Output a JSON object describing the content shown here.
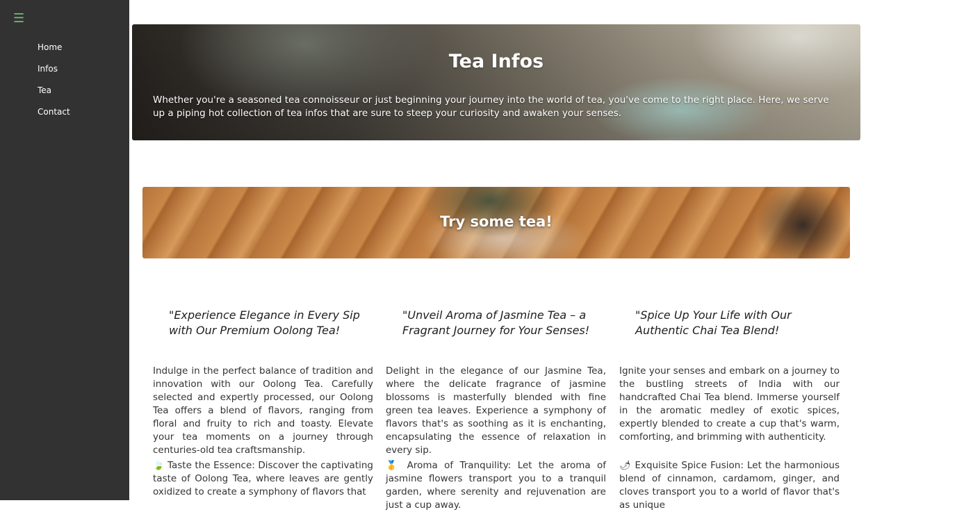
{
  "sidebar": {
    "menu_icon": "hamburger-menu-icon",
    "items": [
      {
        "label": "Home"
      },
      {
        "label": "Infos"
      },
      {
        "label": "Tea"
      },
      {
        "label": "Contact"
      }
    ]
  },
  "hero": {
    "title": "Tea Infos",
    "text": "Whether you're a seasoned tea connoisseur or just beginning your journey into the world of tea, you've come to the right place. Here, we serve up a piping hot collection of tea infos that are sure to steep your curiosity and awaken your senses."
  },
  "banner": {
    "title": "Try some tea!"
  },
  "columns": [
    {
      "title": "\"Experience Elegance in Every Sip with Our Premium Oolong Tea!",
      "body": "Indulge in the perfect balance of tradition and innovation with our Oolong Tea. Carefully selected and expertly processed, our Oolong Tea offers a blend of flavors, ranging from floral and fruity to rich and toasty. Elevate your tea moments on a journey through centuries-old tea craftsmanship.",
      "feature_emoji": "🍃",
      "feature_text": "Taste the Essence: Discover the captivating taste of Oolong Tea, where leaves are gently oxidized to create a symphony of flavors that"
    },
    {
      "title": "\"Unveil Aroma of Jasmine Tea – a Fragrant Journey for Your Senses!",
      "body": "Delight in the elegance of our Jasmine Tea, where the delicate fragrance of jasmine blossoms is masterfully blended with fine green tea leaves. Experience a symphony of flavors that's as soothing as it is enchanting, encapsulating the essence of relaxation in every sip.",
      "feature_emoji": "🥇",
      "feature_text": "Aroma of Tranquility: Let the aroma of jasmine flowers transport you to a tranquil garden, where serenity and rejuvenation are just a cup away."
    },
    {
      "title": "\"Spice Up Your Life with Our Authentic Chai Tea Blend!",
      "body": "Ignite your senses and embark on a journey to the bustling streets of India with our handcrafted Chai Tea blend. Immerse yourself in the aromatic medley of exotic spices, expertly blended to create a cup that's warm, comforting, and brimming with authenticity.",
      "feature_emoji": "🌶",
      "feature_text": "Exquisite Spice Fusion: Let the harmonious blend of cinnamon, cardamom, ginger, and cloves transport you to a world of flavor that's as unique"
    }
  ]
}
